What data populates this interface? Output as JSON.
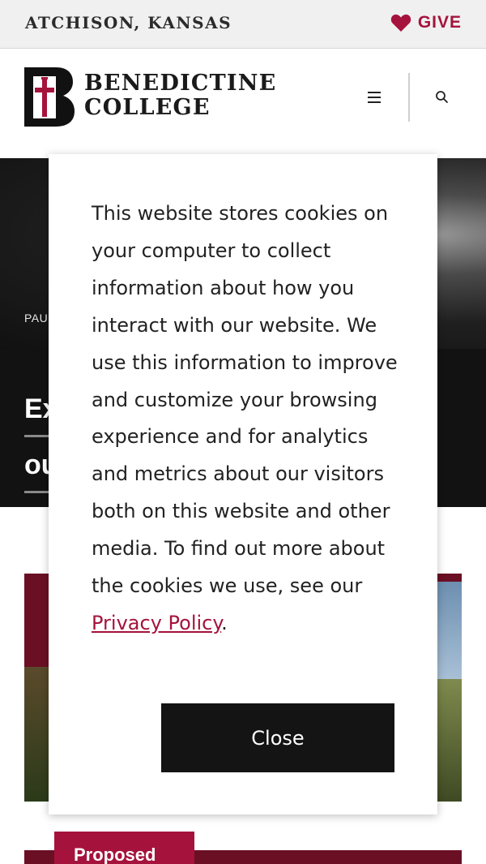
{
  "topbar": {
    "location": "ATCHISON, KANSAS",
    "give_label": "GIVE"
  },
  "header": {
    "logo_line1": "BENEDICTINE",
    "logo_line2": "COLLEGE"
  },
  "hero": {
    "breadcrumb": "PAU",
    "title_line1": "Ex",
    "title_line2": "ou"
  },
  "card": {
    "tag": "Proposed"
  },
  "cookie_modal": {
    "text": "This website stores cookies on your computer to collect information about how you interact with our website. We use this information to improve and customize your browsing experience and for analytics and metrics about our visitors both on this website and other media. To find out more about the cookies we use, see our ",
    "link_label": "Privacy Policy",
    "after_link": ".",
    "close_label": "Close"
  },
  "colors": {
    "brand_crimson": "#a5133c",
    "dark_maroon": "#6b0f24",
    "button_dark": "#141414"
  },
  "icons": {
    "give": "heart-icon",
    "menu": "hamburger-menu-icon",
    "search": "search-icon",
    "logo": "benedictine-b-cross-logo"
  }
}
